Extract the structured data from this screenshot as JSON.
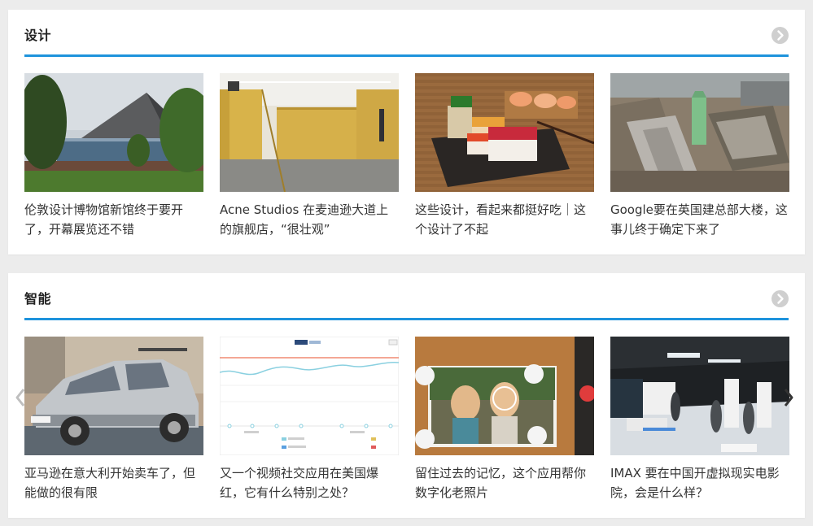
{
  "sections": [
    {
      "title": "设计",
      "more_icon": "chevron-right-circle-icon",
      "articles": [
        {
          "title": "伦敦设计博物馆新馆终于要开了，开幕展览还不错",
          "image": "museum-building-photo"
        },
        {
          "title": "Acne Studios 在麦迪逊大道上的旗舰店，“很壮观”",
          "image": "gold-interior-store-photo"
        },
        {
          "title": "这些设计，看起来都挺好吃｜这个设计了不起",
          "image": "sushi-soap-photo"
        },
        {
          "title": "Google要在英国建总部大楼，这事儿终于确定下来了",
          "image": "london-aerial-photo"
        }
      ]
    },
    {
      "title": "智能",
      "more_icon": "chevron-right-circle-icon",
      "articles": [
        {
          "title": "亚马逊在意大利开始卖车了，但能做的很有限",
          "image": "silver-car-photo"
        },
        {
          "title": "又一个视频社交应用在美国爆红，它有什么特别之处？",
          "image": "line-chart-screenshot"
        },
        {
          "title": "留住过去的记忆，这个应用帮你数字化老照片",
          "image": "photo-scan-app-photo"
        },
        {
          "title": "IMAX 要在中国开虚拟现实电影院，会是什么样？",
          "image": "vr-cinema-render"
        }
      ]
    }
  ],
  "carousel": {
    "prev_icon": "chevron-left-icon",
    "next_icon": "chevron-right-icon"
  },
  "colors": {
    "accent": "#1e93dc",
    "background": "#ececec",
    "card": "#ffffff",
    "text": "#333333"
  }
}
